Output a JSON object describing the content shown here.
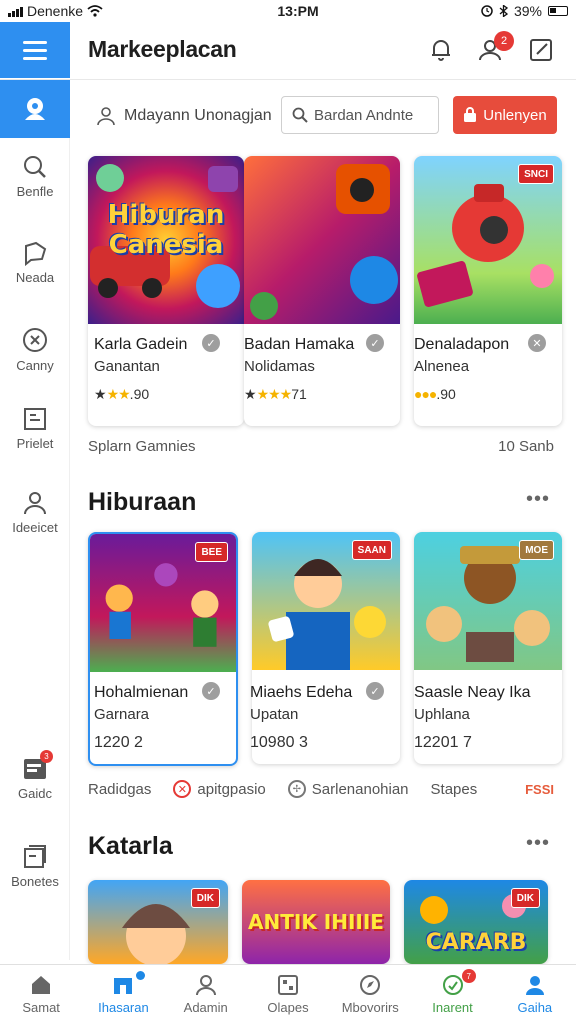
{
  "status_bar": {
    "carrier": "Denenke",
    "time": "13:PM",
    "battery": "39%"
  },
  "header": {
    "title": "Markeeplacan",
    "notification_count": "2"
  },
  "sidebar": {
    "items": [
      {
        "label": "Benfle",
        "icon": "search-icon"
      },
      {
        "label": "Neada",
        "icon": "chat-icon"
      },
      {
        "label": "Canny",
        "icon": "close-circle-icon"
      },
      {
        "label": "Prielet",
        "icon": "document-icon"
      },
      {
        "label": "Ideeicet",
        "icon": "user-icon"
      },
      {
        "label": "Gaidc",
        "icon": "inbox-icon",
        "badge": "3"
      },
      {
        "label": "Bonetes",
        "icon": "files-icon"
      }
    ]
  },
  "search_row": {
    "user_label": "Mdayann Unonagjan",
    "search_text": "Bardan Andnte",
    "cta_label": "Unlenyen"
  },
  "featured": {
    "cards": [
      {
        "title": "Karla Gadein",
        "subtitle": "Ganantan",
        "rating_text": "90",
        "thumb_title": "Hiburan Canesia"
      },
      {
        "title": "Badan Hamaka",
        "subtitle": "Nolidamas",
        "rating_text": "71",
        "thumb_title": ""
      },
      {
        "title": "Denaladapon",
        "subtitle": "Alnenea",
        "rating_text": "90",
        "thumb_tag": "SNCI"
      }
    ],
    "footer_left": "Splarn Gamnies",
    "footer_right": "10 Sanb"
  },
  "section_hiburaan": {
    "title": "Hiburaan",
    "cards": [
      {
        "title": "Hohalmienan",
        "subtitle": "Garnara",
        "meta": "1220  2",
        "thumb_tag": "BEE"
      },
      {
        "title": "Miaehs Edeha",
        "subtitle": "Upatan",
        "meta": "10980  3",
        "thumb_tag": "SAAN"
      },
      {
        "title": "Saasle Neay Ika",
        "subtitle": "Uphlana",
        "meta": "12201  7",
        "thumb_tag": "MOE"
      }
    ],
    "tags": [
      "Radidgas",
      "apitgpasio",
      "Sarlenanohian",
      "Stapes"
    ],
    "tag_right": "FSSI"
  },
  "section_katarla": {
    "title": "Katarla",
    "cards": [
      {
        "thumb_tag": "DIK"
      },
      {
        "thumb_title": "ANTIK IHIIIE"
      },
      {
        "thumb_title": "CARARB",
        "thumb_tag": "DIK"
      }
    ]
  },
  "bottom_nav": {
    "items": [
      {
        "label": "Samat",
        "icon": "home-icon"
      },
      {
        "label": "Ihasaran",
        "icon": "store-icon",
        "active": true
      },
      {
        "label": "Adamin",
        "icon": "profile-icon"
      },
      {
        "label": "Olapes",
        "icon": "grid-icon"
      },
      {
        "label": "Mbovorirs",
        "icon": "compass-icon"
      },
      {
        "label": "Inarent",
        "icon": "bell-icon",
        "badge": "7"
      },
      {
        "label": "Gaiha",
        "icon": "person-icon",
        "active": true
      }
    ]
  },
  "colors": {
    "accent": "#2e8ff0",
    "cta": "#e74c3c",
    "badge": "#e53935",
    "active_nav": "#1e88e5",
    "star": "#f5b300"
  }
}
